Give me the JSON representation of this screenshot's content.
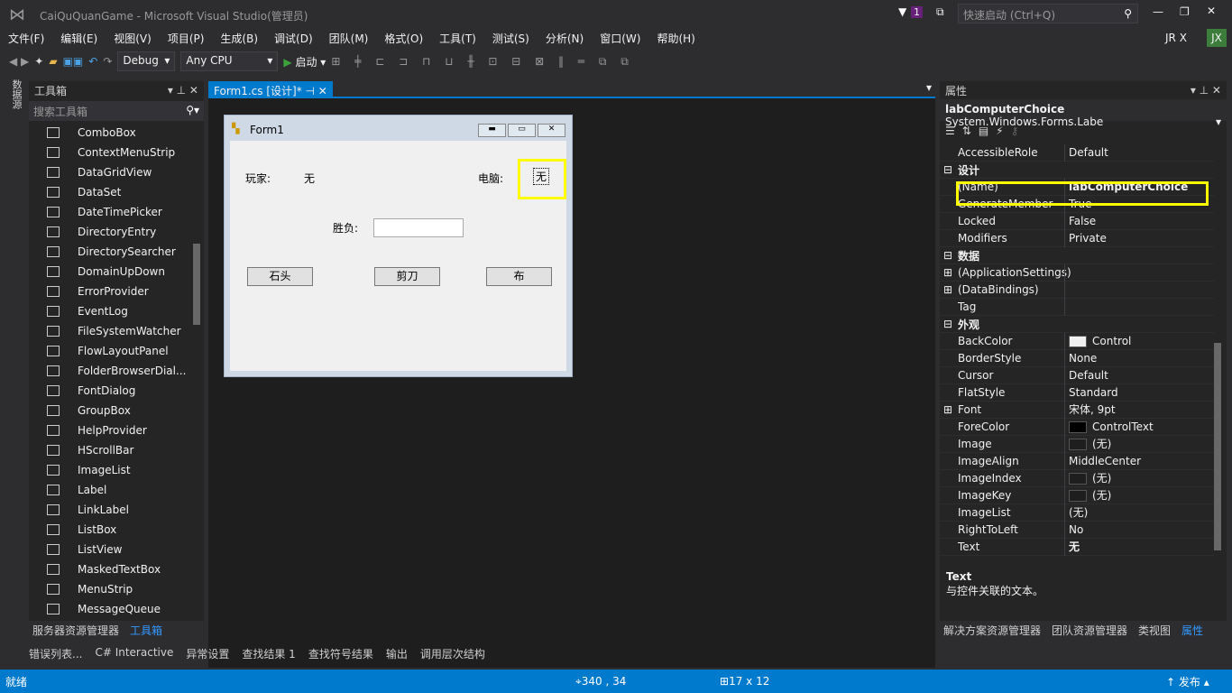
{
  "window": {
    "title": "CaiQuQuanGame - Microsoft Visual Studio(管理员)",
    "notif_count": "1",
    "quick_launch_placeholder": "快速启动 (Ctrl+Q)",
    "user": "JR X",
    "avatar": "JX"
  },
  "menu": [
    "文件(F)",
    "编辑(E)",
    "视图(V)",
    "项目(P)",
    "生成(B)",
    "调试(D)",
    "团队(M)",
    "格式(O)",
    "工具(T)",
    "测试(S)",
    "分析(N)",
    "窗口(W)",
    "帮助(H)"
  ],
  "toolbar": {
    "config": "Debug",
    "platform": "Any CPU",
    "start": "启动"
  },
  "side_strip": "数据源",
  "toolbox": {
    "title": "工具箱",
    "search_placeholder": "搜索工具箱",
    "items": [
      "ComboBox",
      "ContextMenuStrip",
      "DataGridView",
      "DataSet",
      "DateTimePicker",
      "DirectoryEntry",
      "DirectorySearcher",
      "DomainUpDown",
      "ErrorProvider",
      "EventLog",
      "FileSystemWatcher",
      "FlowLayoutPanel",
      "FolderBrowserDial...",
      "FontDialog",
      "GroupBox",
      "HelpProvider",
      "HScrollBar",
      "ImageList",
      "Label",
      "LinkLabel",
      "ListBox",
      "ListView",
      "MaskedTextBox",
      "MenuStrip",
      "MessageQueue"
    ],
    "bottom_tabs": [
      "服务器资源管理器",
      "工具箱"
    ]
  },
  "editor": {
    "tab": "Form1.cs [设计]*"
  },
  "form": {
    "title": "Form1",
    "player_label": "玩家:",
    "player_value": "无",
    "computer_label": "电脑:",
    "computer_value": "无",
    "result_label": "胜负:",
    "result_value": "",
    "buttons": [
      "石头",
      "剪刀",
      "布"
    ]
  },
  "properties": {
    "title": "属性",
    "object_name": "labComputerChoice",
    "object_type": "System.Windows.Forms.Labe",
    "rows": [
      {
        "name": "AccessibleRole",
        "value": "Default"
      },
      {
        "category": "设计"
      },
      {
        "name": "(Name)",
        "value": "labComputerChoice",
        "bold": true
      },
      {
        "name": "GenerateMember",
        "value": "True"
      },
      {
        "name": "Locked",
        "value": "False"
      },
      {
        "name": "Modifiers",
        "value": "Private"
      },
      {
        "category": "数据"
      },
      {
        "name": "(ApplicationSettings)",
        "value": "",
        "expand": true
      },
      {
        "name": "(DataBindings)",
        "value": "",
        "expand": true
      },
      {
        "name": "Tag",
        "value": ""
      },
      {
        "category": "外观"
      },
      {
        "name": "BackColor",
        "value": "Control",
        "swatch": "#f0f0f0"
      },
      {
        "name": "BorderStyle",
        "value": "None"
      },
      {
        "name": "Cursor",
        "value": "Default"
      },
      {
        "name": "FlatStyle",
        "value": "Standard"
      },
      {
        "name": "Font",
        "value": "宋体, 9pt",
        "expand": true
      },
      {
        "name": "ForeColor",
        "value": "ControlText",
        "swatch": "#000000"
      },
      {
        "name": "Image",
        "value": "(无)",
        "swatch": "#1e1e1e"
      },
      {
        "name": "ImageAlign",
        "value": "MiddleCenter"
      },
      {
        "name": "ImageIndex",
        "value": "(无)",
        "swatch": "#1e1e1e"
      },
      {
        "name": "ImageKey",
        "value": "(无)",
        "swatch": "#1e1e1e"
      },
      {
        "name": "ImageList",
        "value": "(无)"
      },
      {
        "name": "RightToLeft",
        "value": "No"
      },
      {
        "name": "Text",
        "value": "无",
        "bold": true
      }
    ],
    "desc_title": "Text",
    "desc_text": "与控件关联的文本。",
    "bottom_tabs": [
      "解决方案资源管理器",
      "团队资源管理器",
      "类视图",
      "属性"
    ]
  },
  "bottom_tabs": [
    "错误列表...",
    "C# Interactive",
    "异常设置",
    "查找结果 1",
    "查找符号结果",
    "输出",
    "调用层次结构"
  ],
  "status": {
    "text": "就绪",
    "position": "340 , 34",
    "size": "17 x 12",
    "publish": "发布"
  },
  "colors": {
    "accent": "#007acc",
    "highlight": "#ffff00"
  }
}
